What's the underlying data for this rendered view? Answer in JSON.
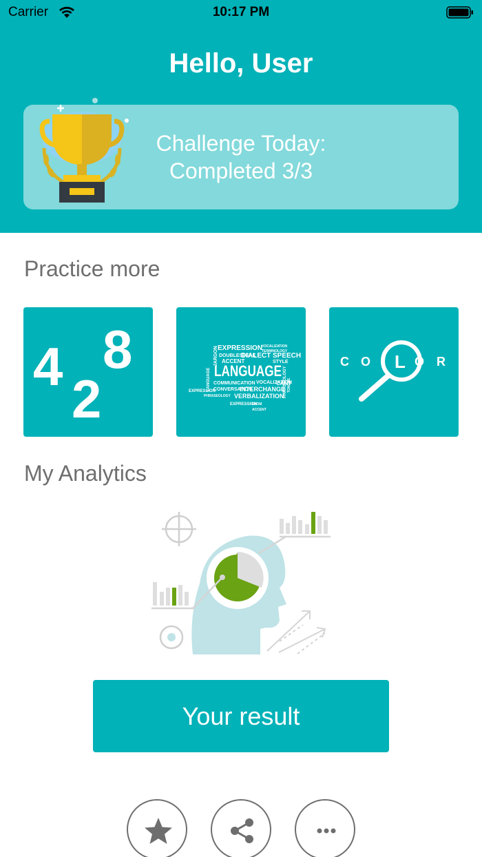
{
  "status_bar": {
    "carrier": "Carrier",
    "time": "10:17 PM"
  },
  "header": {
    "greeting": "Hello, User"
  },
  "challenge": {
    "line1": "Challenge Today:",
    "line2": "Completed 3/3",
    "completed": 3,
    "total": 3
  },
  "practice": {
    "title": "Practice more",
    "tiles": [
      {
        "name": "numbers",
        "text": [
          "4",
          "2",
          "8"
        ]
      },
      {
        "name": "language",
        "words": [
          "EXPRESSION",
          "LANGUAGE",
          "DIALECT",
          "SPEECH",
          "ACCENT",
          "JARGON",
          "INTERCHANGE",
          "VERBALIZATION",
          "COMMUNICATION",
          "CONVERSATION",
          "STYLE",
          "CANT",
          "TERMINOLOGY",
          "TONGUE",
          "DOUBLESPEAK",
          "VOCALIZATION",
          "IDIOM",
          "PHRASEOLOGY"
        ]
      },
      {
        "name": "color",
        "letters": [
          "C",
          "O",
          "L",
          "O",
          "R"
        ]
      }
    ]
  },
  "analytics": {
    "title": "My Analytics"
  },
  "result_button": {
    "label": "Your result"
  },
  "actions": [
    {
      "name": "favorite",
      "icon": "star-icon"
    },
    {
      "name": "share",
      "icon": "share-icon"
    },
    {
      "name": "more",
      "icon": "more-icon"
    }
  ],
  "colors": {
    "accent": "#01b2b8",
    "card": "#83d9db",
    "analytics_green": "#6aa313"
  }
}
